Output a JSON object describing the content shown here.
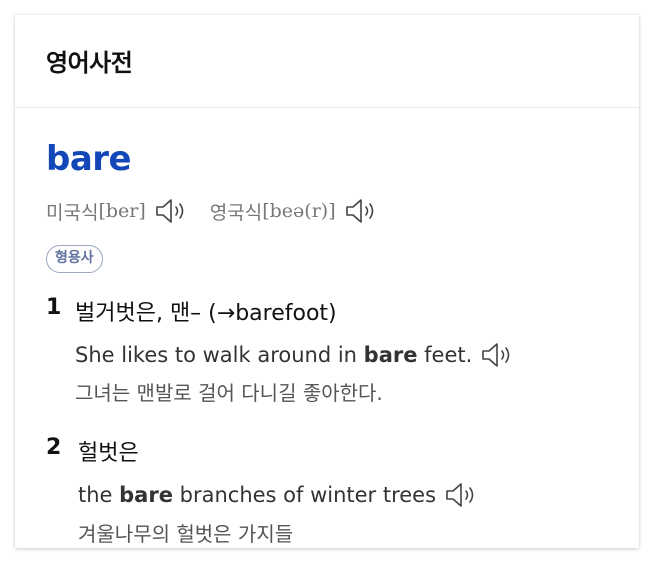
{
  "card": {
    "title": "영어사전"
  },
  "entry": {
    "word": "bare",
    "pronunciations": [
      {
        "label": "미국식",
        "ipa": "[ber]"
      },
      {
        "label": "영국식",
        "ipa": "[beə(r)]"
      }
    ],
    "part_of_speech": "형용사",
    "senses": [
      {
        "number": "1",
        "definition": "벌거벗은, 맨– (→barefoot)",
        "example": {
          "before": "She likes to walk around in ",
          "highlight": "bare",
          "after": " feet.",
          "translation": "그녀는 맨발로 걸어 다니길 좋아한다."
        }
      },
      {
        "number": "2",
        "definition": "헐벗은",
        "example": {
          "before": "the ",
          "highlight": "bare",
          "after": " branches of winter trees",
          "translation": "겨울나무의 헐벗은 가지들"
        }
      }
    ]
  },
  "colors": {
    "word": "#1347b8",
    "badge_border": "#9aa6c2",
    "badge_text": "#6373a0",
    "muted": "#777777"
  },
  "icons": {
    "speaker": "speaker-icon"
  }
}
